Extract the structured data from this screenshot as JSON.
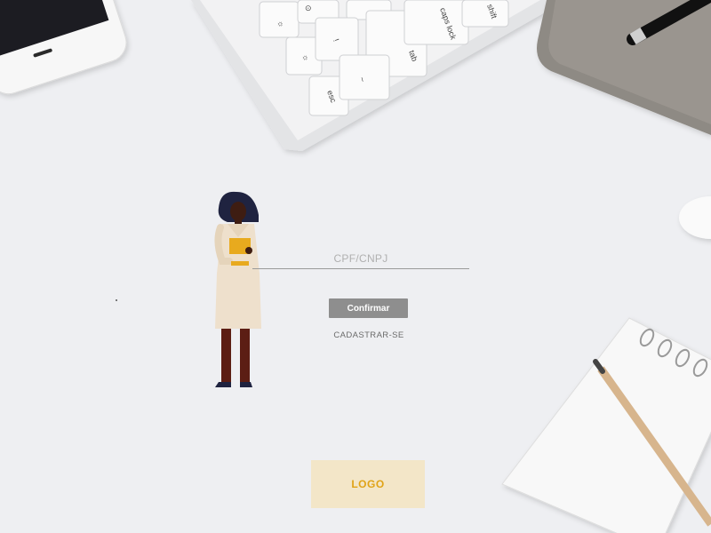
{
  "form": {
    "cpf_placeholder": "CPF/CNPJ",
    "cpf_value": "",
    "confirm_label": "Confirmar",
    "signup_label": "CADASTRAR-SE"
  },
  "logo": {
    "label": "LOGO"
  },
  "colors": {
    "background": "#eeeff2",
    "button": "#8e8e8e",
    "logo_bg": "#f3e6c8",
    "logo_text": "#e0a317",
    "accent_yellow": "#e8aa1e"
  },
  "icons": {
    "illustration": "woman-holding-folder-illustration",
    "phone": "smartphone-photo",
    "keyboard": "keyboard-photo",
    "pen": "pen-photo",
    "notepad": "spiral-notepad-photo",
    "pencil": "pencil-photo",
    "mouse": "mouse-photo",
    "case": "fabric-case-photo"
  }
}
